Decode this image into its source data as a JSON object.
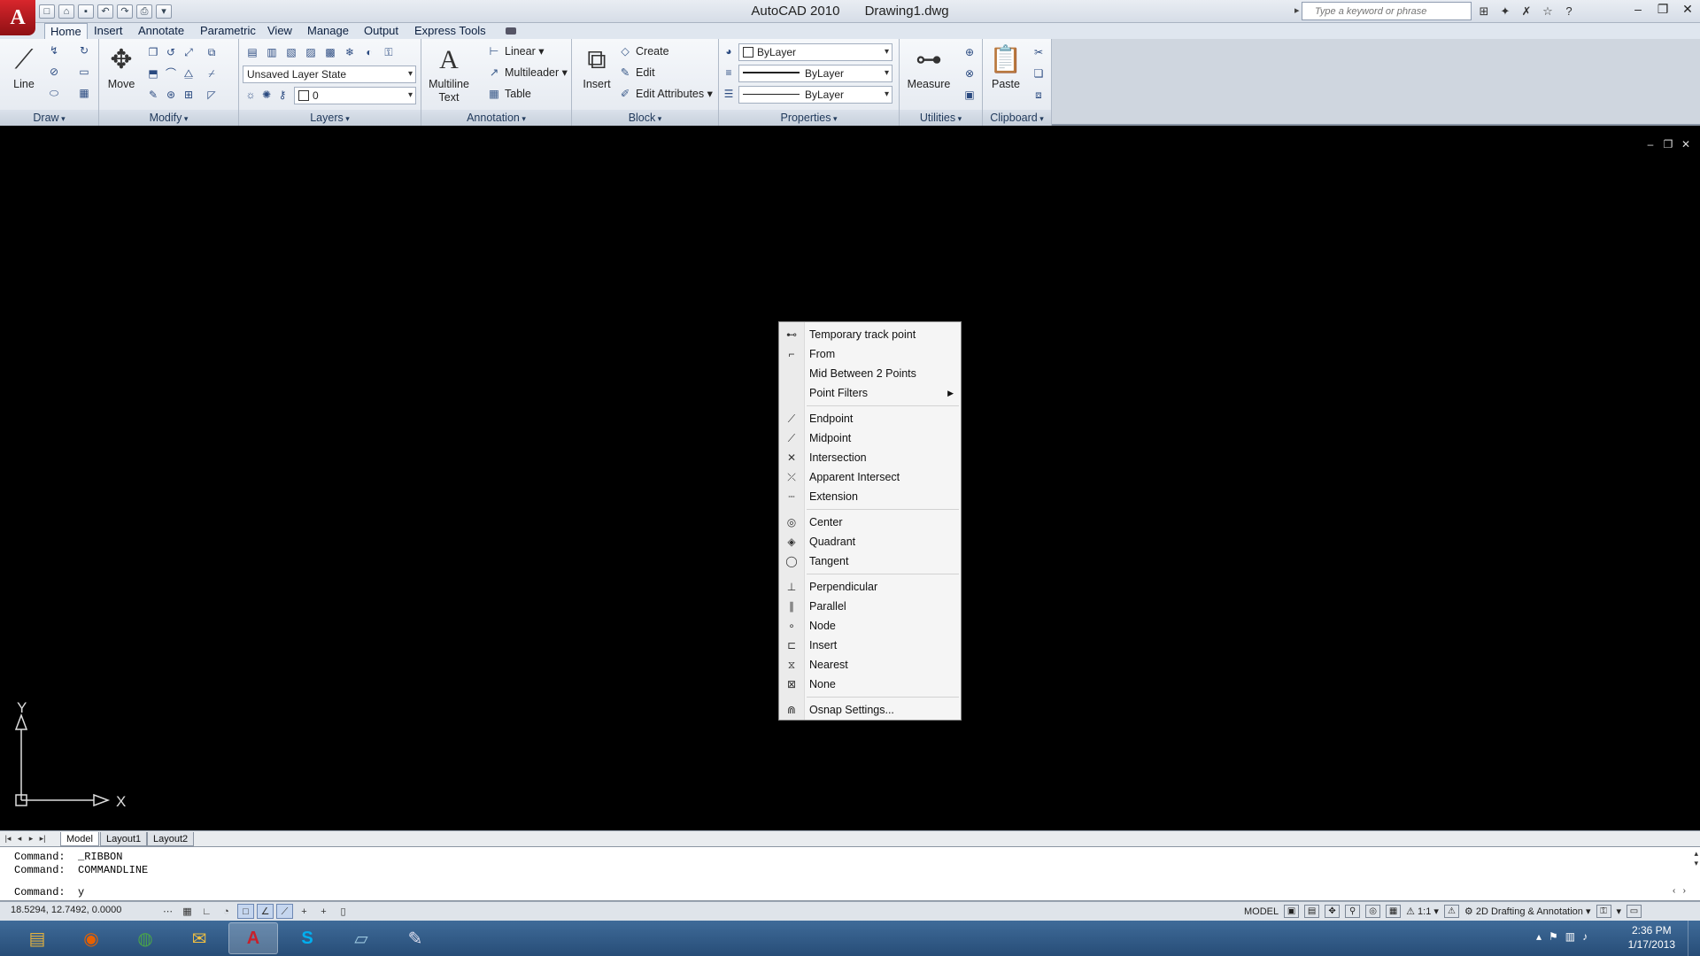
{
  "window": {
    "app_title": "AutoCAD 2010",
    "doc_title": "Drawing1.dwg",
    "search_placeholder": "Type a keyword or phrase"
  },
  "ribbon_tabs": [
    "Home",
    "Insert",
    "Annotate",
    "Parametric",
    "View",
    "Manage",
    "Output",
    "Express Tools"
  ],
  "panels": {
    "draw": {
      "title": "Draw",
      "line": "Line"
    },
    "modify": {
      "title": "Modify",
      "move": "Move"
    },
    "layers": {
      "title": "Layers",
      "layer_state": "Unsaved Layer State",
      "current_layer": "0"
    },
    "annotation": {
      "title": "Annotation",
      "multiline_line1": "Multiline",
      "multiline_line2": "Text",
      "linear": "Linear",
      "multileader": "Multileader",
      "table": "Table"
    },
    "block": {
      "title": "Block",
      "insert": "Insert",
      "create": "Create",
      "edit": "Edit",
      "edit_attributes": "Edit Attributes"
    },
    "properties": {
      "title": "Properties",
      "color": "ByLayer",
      "linetype": "ByLayer",
      "lineweight": "ByLayer"
    },
    "utilities": {
      "title": "Utilities",
      "measure": "Measure"
    },
    "clipboard": {
      "title": "Clipboard",
      "paste": "Paste"
    }
  },
  "context_menu": {
    "groups": [
      [
        {
          "label": "Temporary track point",
          "icon": "track-point-icon",
          "glyph": "⊷"
        },
        {
          "label": "From",
          "icon": "from-icon",
          "glyph": "⌐"
        },
        {
          "label": "Mid Between 2 Points",
          "icon": "",
          "glyph": ""
        },
        {
          "label": "Point Filters",
          "icon": "",
          "glyph": "",
          "submenu": true
        }
      ],
      [
        {
          "label": "Endpoint",
          "icon": "endpoint-icon",
          "glyph": "⟋"
        },
        {
          "label": "Midpoint",
          "icon": "midpoint-icon",
          "glyph": "⟋"
        },
        {
          "label": "Intersection",
          "icon": "intersection-icon",
          "glyph": "✕"
        },
        {
          "label": "Apparent Intersect",
          "icon": "apparent-intersect-icon",
          "glyph": "⤫"
        },
        {
          "label": "Extension",
          "icon": "extension-icon",
          "glyph": "┄"
        }
      ],
      [
        {
          "label": "Center",
          "icon": "center-icon",
          "glyph": "◎"
        },
        {
          "label": "Quadrant",
          "icon": "quadrant-icon",
          "glyph": "◈"
        },
        {
          "label": "Tangent",
          "icon": "tangent-icon",
          "glyph": "◯"
        }
      ],
      [
        {
          "label": "Perpendicular",
          "icon": "perpendicular-icon",
          "glyph": "⊥"
        },
        {
          "label": "Parallel",
          "icon": "parallel-icon",
          "glyph": "∥"
        },
        {
          "label": "Node",
          "icon": "node-icon",
          "glyph": "∘"
        },
        {
          "label": "Insert",
          "icon": "insert-icon",
          "glyph": "⊏"
        },
        {
          "label": "Nearest",
          "icon": "nearest-icon",
          "glyph": "⧖"
        },
        {
          "label": "None",
          "icon": "none-icon",
          "glyph": "⊠"
        }
      ],
      [
        {
          "label": "Osnap Settings...",
          "icon": "osnap-settings-icon",
          "glyph": "⋒"
        }
      ]
    ]
  },
  "ucs": {
    "x_label": "X",
    "y_label": "Y"
  },
  "layout_tabs": [
    "Model",
    "Layout1",
    "Layout2"
  ],
  "command_line": {
    "history": [
      "Command:  _RIBBON",
      "Command:  COMMANDLINE"
    ],
    "prompt": "Command:  y"
  },
  "status_bar": {
    "coordinates": "18.5294, 12.7492, 0.0000",
    "space": "MODEL",
    "annotation_scale": "1:1",
    "workspace": "2D Drafting & Annotation"
  },
  "taskbar": {
    "apps": [
      {
        "name": "file-explorer",
        "glyph": "▤",
        "color": "#e0b040"
      },
      {
        "name": "firefox",
        "glyph": "◉",
        "color": "#e66000"
      },
      {
        "name": "chrome",
        "glyph": "◍",
        "color": "#4aa34a"
      },
      {
        "name": "outlook-folder",
        "glyph": "✉",
        "color": "#f0c040"
      },
      {
        "name": "autocad",
        "glyph": "A",
        "color": "#c8202a",
        "active": true
      },
      {
        "name": "skype",
        "glyph": "S",
        "color": "#00aff0"
      },
      {
        "name": "notes",
        "glyph": "▱",
        "color": "#9cc8e0"
      },
      {
        "name": "paint",
        "glyph": "✎",
        "color": "#e0e0f0"
      }
    ],
    "time": "2:36 PM",
    "date": "1/17/2013"
  }
}
